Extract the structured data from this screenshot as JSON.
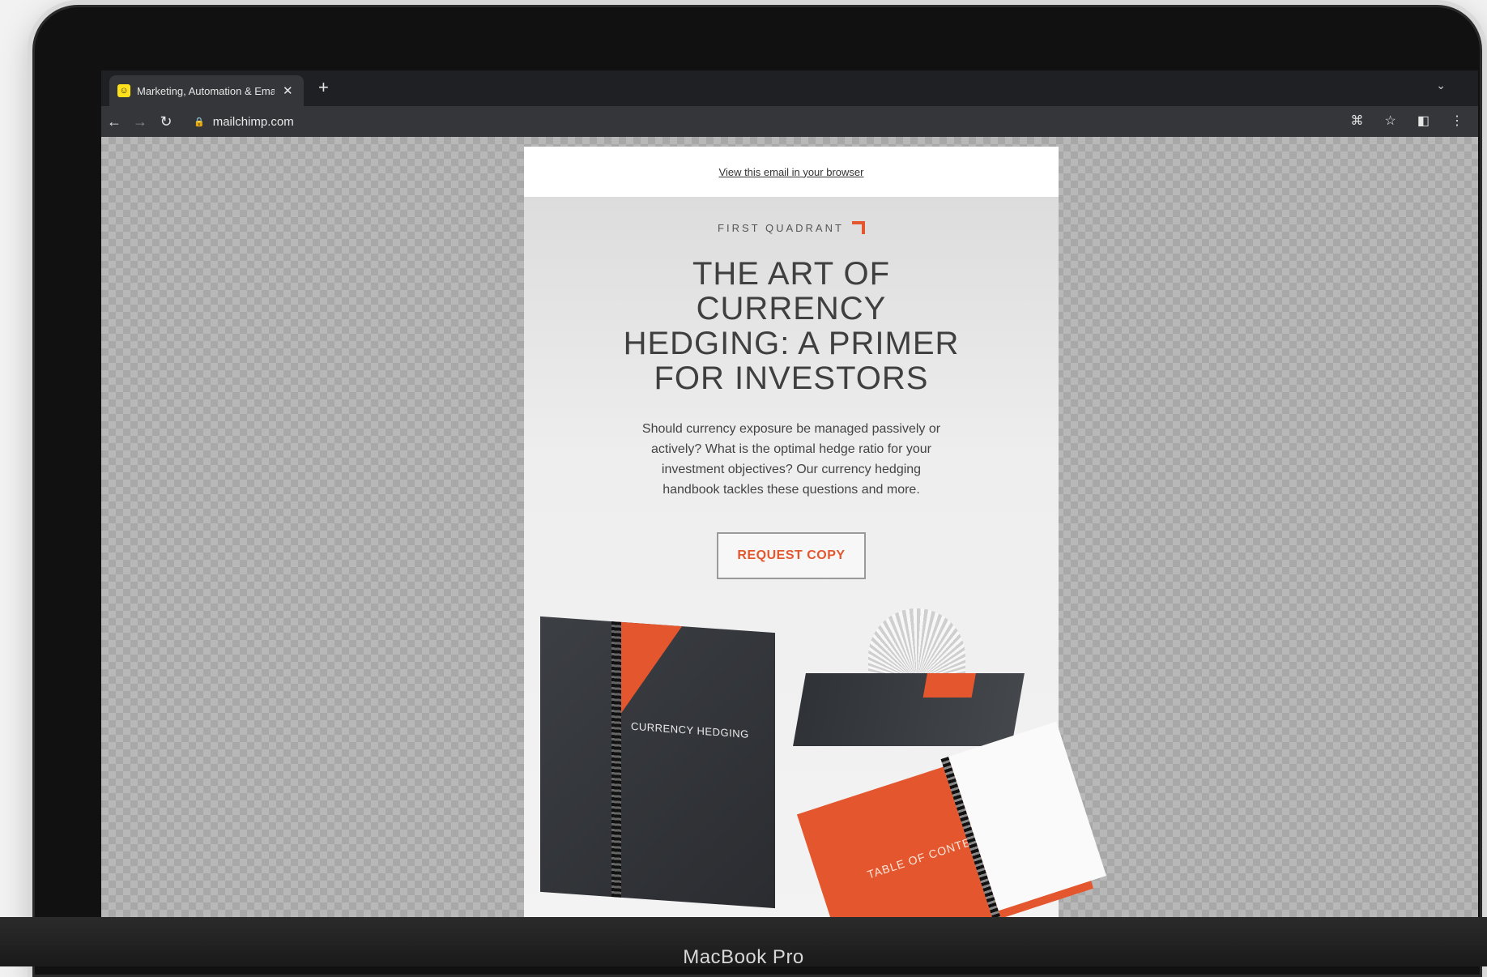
{
  "browser": {
    "tab_title": "Marketing, Automation & Emai",
    "tab_favicon": "mailchimp-favicon",
    "new_tab_label": "+",
    "close_label": "✕",
    "url": "mailchimp.com"
  },
  "email": {
    "view_in_browser": "View this email in your browser",
    "brand": "FIRST QUADRANT",
    "headline": "THE ART OF CURRENCY HEDGING: A PRIMER FOR INVESTORS",
    "body": "Should currency exposure be managed passively or actively? What is the optimal hedge ratio for your investment objectives? Our currency hedging handbook tackles these questions and more.",
    "cta_label": "REQUEST COPY",
    "book_title": "CURRENCY HEDGING",
    "toc_label": "TABLE OF CONTENTS",
    "accent_color": "#e4572e"
  },
  "device": {
    "label": "MacBook Pro"
  }
}
